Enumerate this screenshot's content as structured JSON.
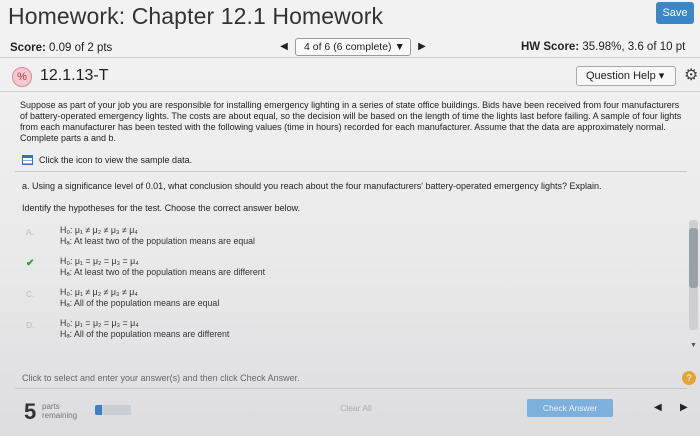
{
  "header": {
    "title": "Homework: Chapter 12.1 Homework",
    "save_label": "Save"
  },
  "scorebar": {
    "score_label": "Score:",
    "score_value": "0.09 of 2 pts",
    "nav_prev_icon": "triangle-left-icon",
    "nav_select_value": "4 of 6 (6 complete)",
    "nav_next_icon": "triangle-right-icon",
    "hw_score_label": "HW Score:",
    "hw_score_value": "35.98%, 3.6 of 10 pt"
  },
  "question": {
    "status_icon": "partial-credit-icon",
    "id": "12.1.13-T",
    "help_label": "Question Help ▾",
    "gear_icon": "gear-icon",
    "prompt": "Suppose as part of your job you are responsible for installing emergency lighting in a series of state office buildings. Bids have been received from four manufacturers of battery-operated emergency lights. The costs are about equal, so the decision will be based on the length of time the lights last before failing. A sample of four lights from each manufacturer has been tested with the following values (time in hours) recorded for each manufacturer. Assume that the data are approximately normal. Complete parts a and b.",
    "sample_link": "Click the icon to view the sample data.",
    "part_a": "a. Using a significance level of 0.01, what conclusion should you reach about the four manufacturers' battery-operated emergency lights? Explain.",
    "identify": "Identify the hypotheses for the test. Choose the correct answer below.",
    "options": [
      {
        "mark": "A.",
        "h0": "H₀: μ₁ ≠ μ₂ ≠ μ₃ ≠ μ₄",
        "ha": "Hₐ: At least two of the population means are equal"
      },
      {
        "mark": "✔",
        "h0": "H₀: μ₁ = μ₂ = μ₃ = μ₄",
        "ha": "Hₐ: At least two of the population means are different"
      },
      {
        "mark": "C.",
        "h0": "H₀: μ₁ ≠ μ₂ ≠ μ₃ ≠ μ₄",
        "ha": "Hₐ: All of the population means are equal"
      },
      {
        "mark": "D.",
        "h0": "H₀: μ₁ = μ₂ = μ₃ = μ₄",
        "ha": "Hₐ: All of the population means are different"
      }
    ],
    "instructions": "Click to select and enter your answer(s) and then click Check Answer."
  },
  "footer": {
    "parts_number": "5",
    "parts_label_1": "parts",
    "parts_label_2": "remaining",
    "progress_fraction": 0.2,
    "clear_all_label": "Clear All",
    "check_answer_label": "Check Answer",
    "help_icon": "?"
  }
}
